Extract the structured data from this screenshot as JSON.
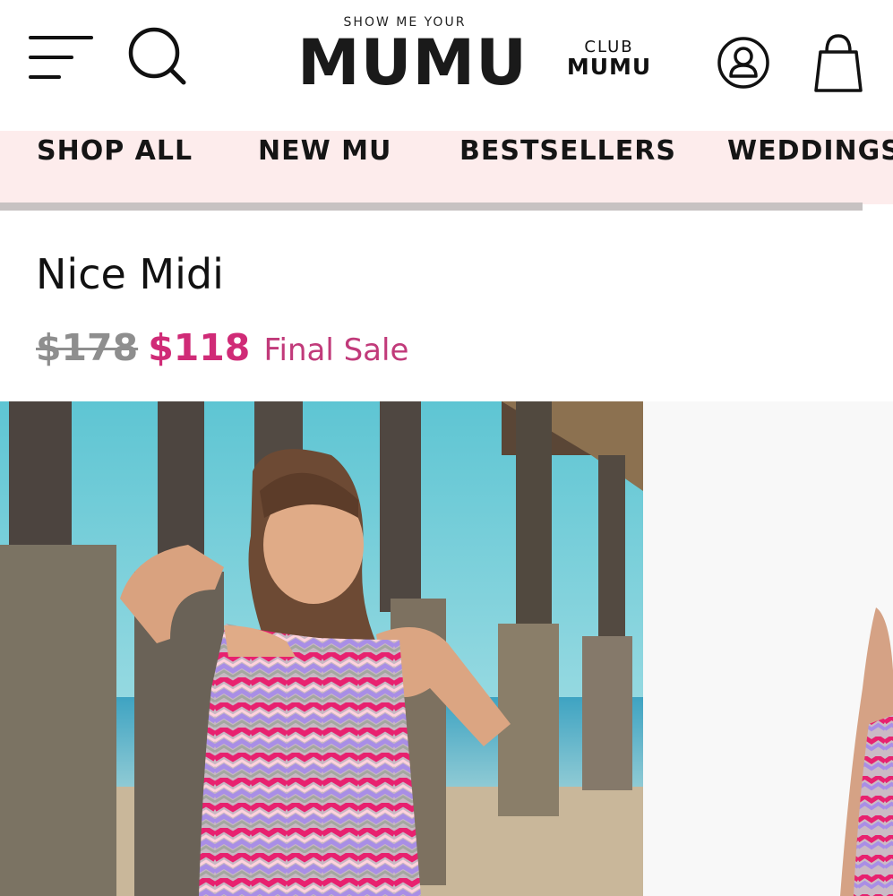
{
  "header": {
    "menu_icon": "hamburger-menu-icon",
    "search_icon": "search-icon",
    "logo_top": "SHOW ME YOUR",
    "logo_main": "MUMU",
    "club_top": "CLUB",
    "club_main": "MUMU",
    "account_icon": "account-icon",
    "bag_icon": "shopping-bag-icon"
  },
  "nav": {
    "items": [
      {
        "label": "SHOP ALL"
      },
      {
        "label": "NEW MU"
      },
      {
        "label": "BESTSELLERS"
      },
      {
        "label": "WEDDINGS"
      }
    ],
    "background": "#fdecec"
  },
  "product": {
    "title": "Nice Midi",
    "price_original": "$178",
    "price_sale": "$118",
    "sale_note": "Final Sale",
    "sale_color": "#d02b77"
  },
  "gallery": {
    "images": [
      {
        "alt": "woman-in-zigzag-dress-under-pier"
      },
      {
        "alt": "zigzag-dress-product-shot"
      }
    ]
  }
}
